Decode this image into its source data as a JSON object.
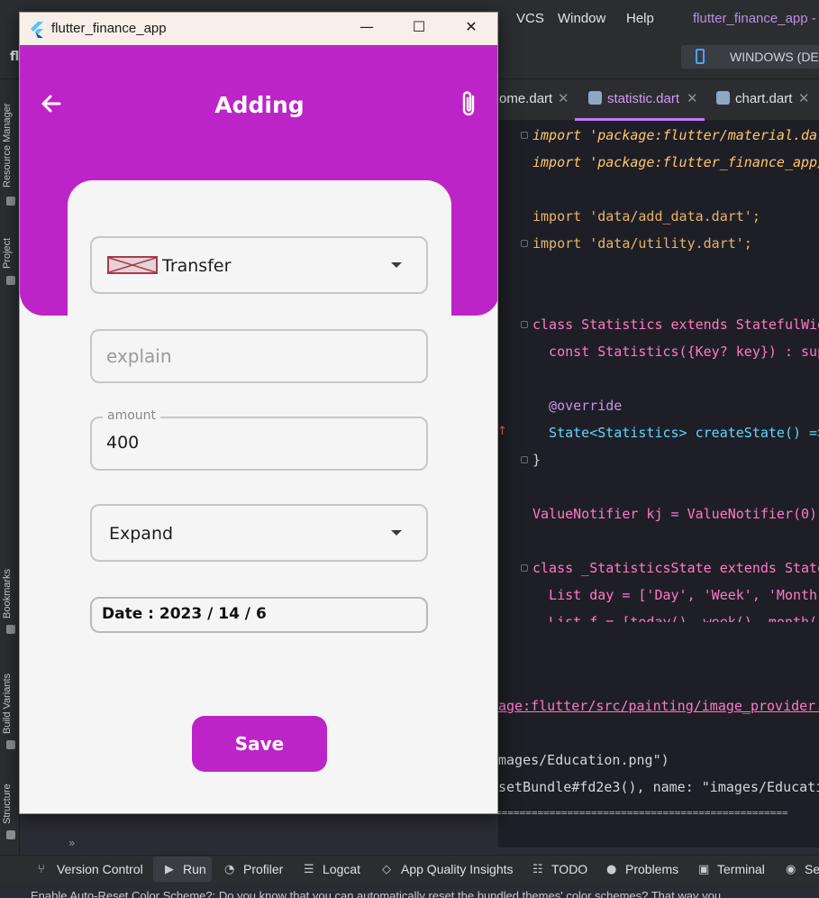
{
  "ide": {
    "menu": [
      "VCS",
      "Window",
      "Help"
    ],
    "project_title": "flutter_finance_app -",
    "device": "WINDOWS (DE",
    "sidebar_tabs": [
      "Resource Manager",
      "Project",
      "Bookmarks",
      "Build Variants",
      "Structure"
    ],
    "project_short": "fl",
    "tabs": [
      {
        "label": "ome.dart"
      },
      {
        "label": "statistic.dart"
      },
      {
        "label": "chart.dart"
      }
    ],
    "code_lines": [
      "import 'package:flutter/material.dar",
      "import 'package:flutter_finance_app/",
      "import 'data/add_data.dart';",
      "import 'data/utility.dart';",
      "class Statistics extends StatefulWid",
      "  const Statistics({Key? key}) : sup",
      "  @override",
      "  State<Statistics> createState() =>",
      "}",
      "ValueNotifier kj = ValueNotifier(0);",
      "class _StatisticsState extends State",
      "  List day = ['Day', 'Week', 'Month",
      "  List f = [today(), week(), month("
    ],
    "console": {
      "link": "age:flutter/src/painting/image_provider.",
      "line1": "mages/Education.png\")",
      "line2": "setBundle#fd2e3(), name: \"images/Educati",
      "dashes": "===================================================================================================================",
      "prompt": "»"
    },
    "bottom_tools": [
      "Version Control",
      "Run",
      "Profiler",
      "Logcat",
      "App Quality Insights",
      "TODO",
      "Problems",
      "Terminal",
      "Ser"
    ],
    "status_message": "Enable Auto-Reset Color Scheme?: Do you know that you can automatically reset the bundled themes' color schemes? That way you"
  },
  "app": {
    "window_title": "flutter_finance_app",
    "header_title": "Adding",
    "category": {
      "selected": "Transfer"
    },
    "explain": {
      "placeholder": "explain"
    },
    "amount": {
      "label": "amount",
      "value": "400"
    },
    "type": {
      "selected": "Expand"
    },
    "date": {
      "text": "Date : 2023 / 14 / 6"
    },
    "save_label": "Save",
    "colors": {
      "primary": "#bd24c8",
      "background": "#f5f5f6"
    }
  }
}
